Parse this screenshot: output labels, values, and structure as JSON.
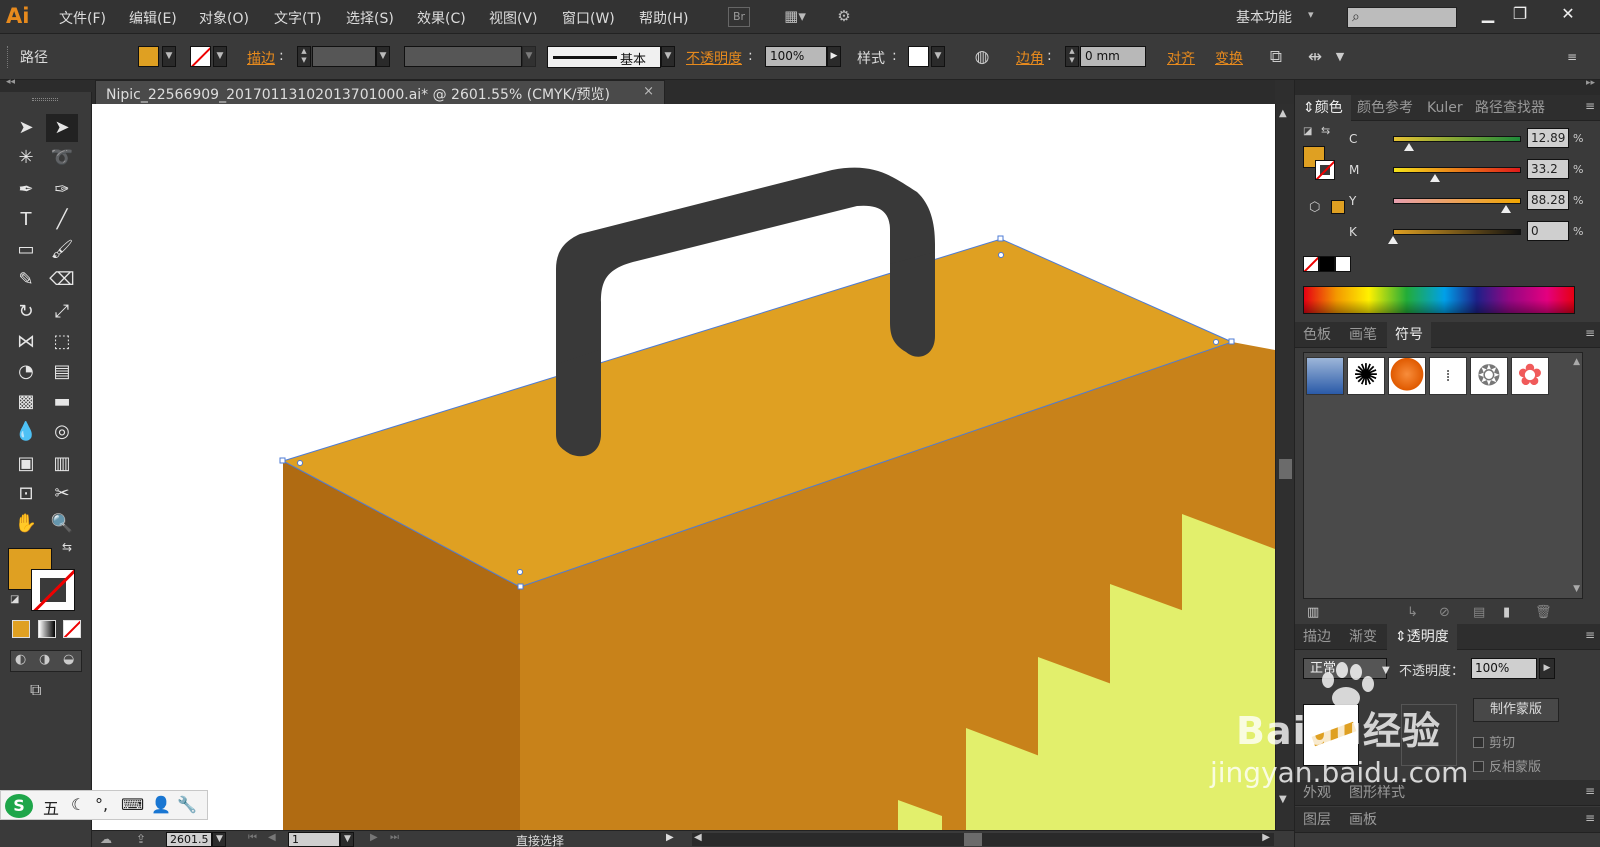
{
  "app": {
    "logo_text": "Ai",
    "menu": [
      "文件(F)",
      "编辑(E)",
      "对象(O)",
      "文字(T)",
      "选择(S)",
      "效果(C)",
      "视图(V)",
      "窗口(W)",
      "帮助(H)"
    ],
    "bridge_label": "Br",
    "workspace": "基本功能"
  },
  "control_bar": {
    "selection_type": "路径",
    "stroke_link": "描边",
    "stroke_profile": "基本",
    "opacity_link": "不透明度",
    "opacity_value": "100%",
    "style_label": "样式",
    "corner_link": "边角",
    "corner_value": "0 mm",
    "align_link": "对齐",
    "transform_link": "变换",
    "fill_color": "#dfa022"
  },
  "document": {
    "tab_title": "Nipic_22566909_20170113102013701000.ai* @ 2601.55% (CMYK/预览)",
    "close_glyph": "×"
  },
  "status_bar": {
    "zoom": "2601.5",
    "artboard": "1",
    "tool_name": "直接选择"
  },
  "color_panel": {
    "tabs": [
      "颜色",
      "颜色参考",
      "Kuler",
      "路径查找器"
    ],
    "channels": [
      {
        "letter": "C",
        "value": "12.89",
        "pct": "%",
        "level": 0.1289
      },
      {
        "letter": "M",
        "value": "33.2",
        "pct": "%",
        "level": 0.332
      },
      {
        "letter": "Y",
        "value": "88.28",
        "pct": "%",
        "level": 0.8828
      },
      {
        "letter": "K",
        "value": "0",
        "pct": "%",
        "level": 0
      }
    ]
  },
  "symbols_panel": {
    "tabs": [
      "色板",
      "画笔",
      "符号"
    ]
  },
  "transparency_panel": {
    "tabs": [
      "描边",
      "渐变",
      "透明度"
    ],
    "blend_mode": "正常",
    "opacity_label": "不透明度：",
    "opacity_value": "100%",
    "make_mask": "制作蒙版",
    "clip": "剪切",
    "invert_mask": "反相蒙版"
  },
  "appearance_panel": {
    "tabs": [
      "外观",
      "图形样式"
    ]
  },
  "layers_panel": {
    "tabs": [
      "图层",
      "画板"
    ]
  },
  "ime": {
    "logo": "S",
    "mode": "五"
  },
  "watermark": {
    "brand": "Baidu经验",
    "url": "jingyan.baidu.com"
  },
  "colors": {
    "fill": "#dfa022",
    "box_side": "#c8821a",
    "box_front": "#b06b12",
    "handle": "#393939",
    "accent": "#e78a1d",
    "selection": "#4d7bd6",
    "stairs": "#e2ef6c"
  }
}
